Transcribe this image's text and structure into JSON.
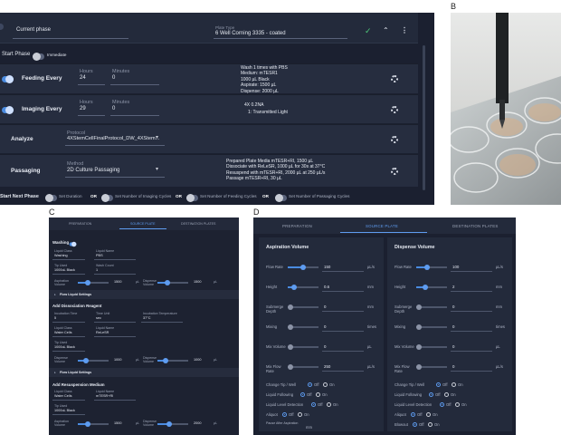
{
  "panel_labels": {
    "a": "",
    "b": "B",
    "c": "C",
    "d": "D"
  },
  "panelA": {
    "current_phase_label": "Current phase",
    "plate_type_label": "Plate Type",
    "plate_type_value": "6 Well Corning 3335 - coated",
    "start_phase_label": "Start Phase",
    "immediate_label": "Immediate",
    "feeding": {
      "label": "Feeding Every",
      "hours_label": "Hours",
      "hours_value": "24",
      "minutes_label": "Minutes",
      "minutes_value": "0",
      "bullets": [
        "Wash 1 times with PBS",
        "Medium: mTESR1",
        "1000 µL Black",
        "Aspirate: 1500 µL",
        "Dispense: 2000 µL"
      ]
    },
    "imaging": {
      "label": "Imaging Every",
      "hours_label": "Hours",
      "hours_value": "29",
      "minutes_label": "Minutes",
      "minutes_value": "0",
      "info_top": "4X 0.2NA",
      "info_bullet": "1: Transmitted Light"
    },
    "analyze": {
      "label": "Analyze",
      "protocol_label": "Protocol",
      "protocol_value": "4XStemCellFinalProtocol_DW_4XStem..."
    },
    "passaging": {
      "label": "Passaging",
      "method_label": "Method",
      "method_value": "2D Culture Passaging",
      "bullets": [
        "Prepared Plate Media mTESR+RI, 1500 µL",
        "Dissociate with ReLeSR, 1000 µL for 30s at 37°C",
        "Resuspend with mTESR+RI, 2000 µL at 250 µL/s",
        "Passage mTESR+RI, 30 µL"
      ]
    },
    "start_next_phase_label": "Start Next Phase",
    "options": [
      "Set Duration",
      "Set Number of Imaging Cycles",
      "Set Number of Feeding Cycles",
      "Set Number of Passaging Cycles"
    ],
    "or_label": "OR"
  },
  "panelC": {
    "tabs": [
      "PREPARATION",
      "SOURCE PLATE",
      "DESTINATION PLATES"
    ],
    "washing_label": "Washing",
    "liquid_class_label": "Liquid Class",
    "liquid_class_value": "Washing",
    "liquid_name_label": "Liquid Name",
    "liquid_name_value": "PBS",
    "tip_used_label": "Tip Used",
    "tip_used_value": "1000uL Black",
    "wash_count_label": "Wash Count",
    "wash_count_value": "1",
    "aspiration_volume_label": "Aspiration Volume",
    "aspiration_volume_value": "1500",
    "dispense_volume_label": "Dispense Volume",
    "dispense_volume_value": "1500",
    "unit_ul": "µL",
    "flow_liquid_settings": "Flow Liquid Settings",
    "add_dissociation_label": "Add Dissociation Reagent",
    "incubation_time_label": "Incubation Time",
    "incubation_time_value": "5",
    "time_unit_label": "Time Unit",
    "time_unit_value": "sec",
    "incubation_temp_label": "Incubation Temperature",
    "incubation_temp_value": "37°C",
    "liquid_class2_value": "Water Cells",
    "liquid_name2_value": "ReLeSR",
    "tip_used2_value": "1000uL Black",
    "dispense_volume2_value": "1000",
    "dispense_volume3_value": "1000",
    "add_resuspension_label": "Add Resuspension Medium",
    "liquid_class3_value": "Water Cells",
    "liquid_name3_value": "mTESR+RI",
    "tip_used3_value": "1000uL Black",
    "asp_volume4_value": "1500",
    "disp_volume4_value": "2000"
  },
  "panelD": {
    "tabs": [
      "PREPARATION",
      "SOURCE PLATE",
      "DESTINATION PLATES"
    ],
    "left": {
      "title": "Aspiration Volume",
      "rows": [
        {
          "label": "Flow Rate",
          "value": "150",
          "unit": "µL/s",
          "fill": 0.5
        },
        {
          "label": "Height",
          "value": "0.6",
          "unit": "mm",
          "fill": 0.2
        },
        {
          "label": "Submerge Depth",
          "value": "0",
          "unit": "mm",
          "fill": 0.0
        },
        {
          "label": "Mixing",
          "value": "0",
          "unit": "times",
          "fill": 0.0
        },
        {
          "label": "Mix Volume",
          "value": "0",
          "unit": "µL",
          "fill": 0.0
        },
        {
          "label": "Mix Flow Rate",
          "value": "250",
          "unit": "µL/s",
          "fill": 0.0
        }
      ],
      "change_tip_label": "Change Tip / Well",
      "liquid_following_label": "Liquid Following",
      "liquid_level_label": "Liquid Level Detection",
      "aliquot_label": "Aliquot",
      "pause_label": "Pause After Aspiration",
      "pause_unit": "mm"
    },
    "right": {
      "title": "Dispense Volume",
      "rows": [
        {
          "label": "Flow Rate",
          "value": "100",
          "unit": "µL/s",
          "fill": 0.35
        },
        {
          "label": "Height",
          "value": "2",
          "unit": "mm",
          "fill": 0.3
        },
        {
          "label": "Submerge Depth",
          "value": "0",
          "unit": "mm",
          "fill": 0.0
        },
        {
          "label": "Mixing",
          "value": "0",
          "unit": "times",
          "fill": 0.0
        },
        {
          "label": "Mix Volume",
          "value": "0",
          "unit": "µL",
          "fill": 0.0
        },
        {
          "label": "Mix Flow Rate",
          "value": "0",
          "unit": "µL/s",
          "fill": 0.0
        }
      ],
      "change_tip_label": "Change Tip / Well",
      "liquid_following_label": "Liquid Following",
      "liquid_level_label": "Liquid Level Detection",
      "aliquot_label": "Aliquot",
      "blowout_label": "Blowout"
    },
    "off_label": "Off",
    "on_label": "On"
  },
  "colors": {
    "accent": "#4a8be0",
    "panel_bg": "#1b2030",
    "row_bg": "#262d3f"
  }
}
